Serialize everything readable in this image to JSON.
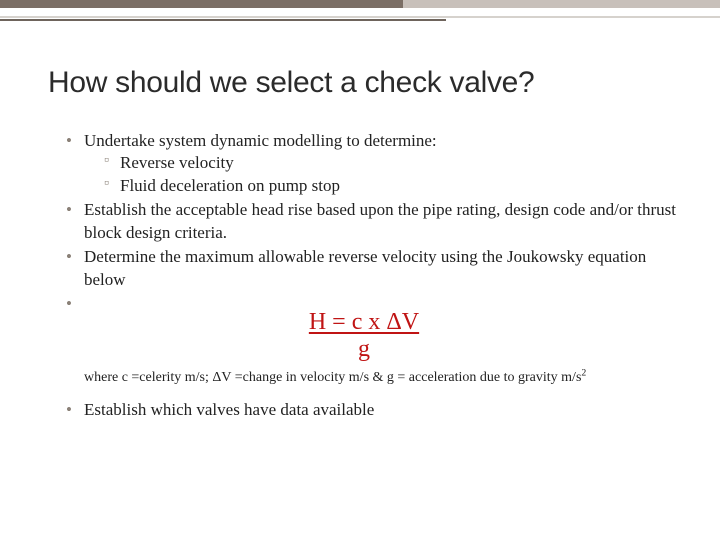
{
  "slide": {
    "title": "How should we select a check valve?",
    "bullets": {
      "b1": "Undertake system dynamic modelling to determine:",
      "b1_sub1": "Reverse velocity",
      "b1_sub2": "Fluid deceleration on pump stop",
      "b2": "Establish the acceptable head rise based upon the pipe rating, design code and/or thrust block design criteria.",
      "b3": "Determine the maximum allowable reverse velocity using the Joukowsky equation below",
      "b5": "Establish which valves have data available"
    },
    "equation": {
      "numerator": "H = c x ΔV",
      "denominator": "g"
    },
    "definition_prefix": "where  c =celerity m/s; ΔV =change in velocity m/s & g = acceleration due to gravity m/s",
    "definition_exponent": "2"
  }
}
